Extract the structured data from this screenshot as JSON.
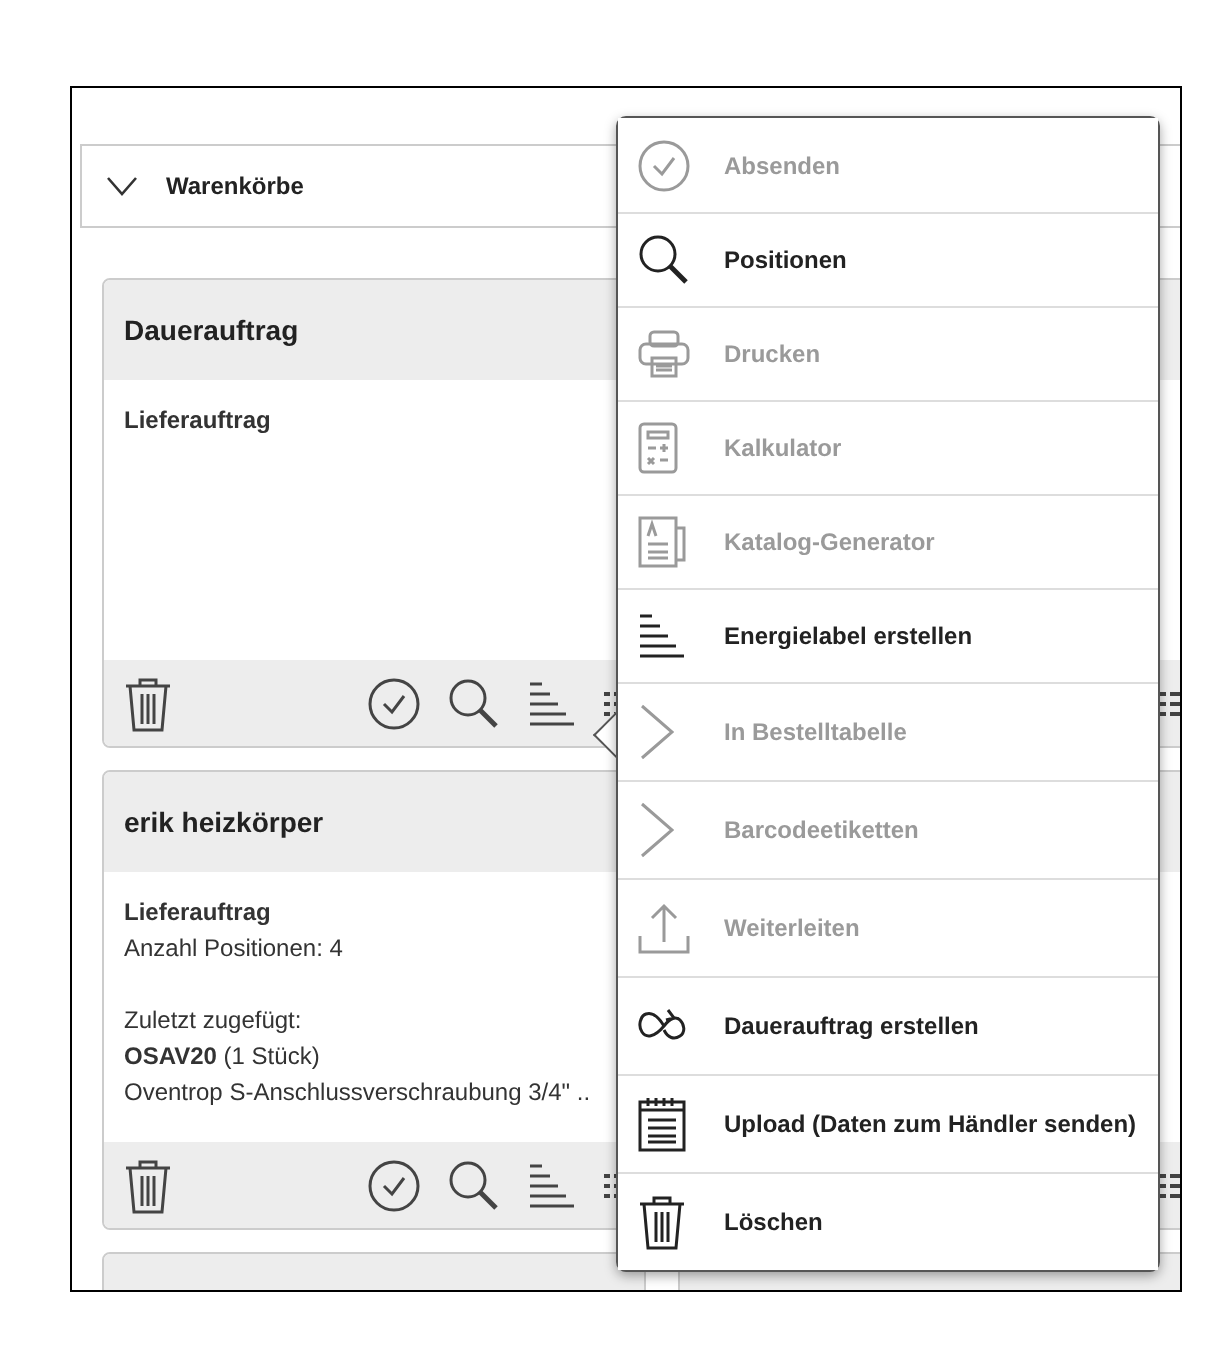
{
  "section": {
    "title": "Warenkörbe",
    "expanded": true
  },
  "carts": [
    {
      "title": "Dauerauftrag",
      "lines": [
        {
          "text": "Lieferauftrag",
          "kind": "bold"
        }
      ]
    },
    {
      "title": "erik heizkörper",
      "lines": [
        {
          "text": "Lieferauftrag",
          "kind": "bold"
        },
        {
          "text": "Anzahl Positionen: 4",
          "kind": "plain"
        },
        {
          "text": "Zuletzt zugefügt:",
          "kind": "spaced"
        },
        {
          "text": "**OSAV20** (1 Stück)",
          "kind": "plain"
        },
        {
          "text": "Oventrop S-Anschlussverschraubung 3/4\" ..",
          "kind": "plain"
        }
      ]
    }
  ],
  "menu": [
    {
      "label": "Absenden",
      "disabled": true
    },
    {
      "label": "Positionen",
      "disabled": false
    },
    {
      "label": "Drucken",
      "disabled": true
    },
    {
      "label": "Kalkulator",
      "disabled": true
    },
    {
      "label": "Katalog-Generator",
      "disabled": true
    },
    {
      "label": "Energielabel erstellen",
      "disabled": false
    },
    {
      "label": "In Bestelltabelle",
      "disabled": true
    },
    {
      "label": "Barcodeetiketten",
      "disabled": true
    },
    {
      "label": "Weiterleiten",
      "disabled": true
    },
    {
      "label": "Dauerauftrag erstellen",
      "disabled": false
    },
    {
      "label": "Upload (Daten zum Händler senden)",
      "disabled": false
    },
    {
      "label": "Löschen",
      "disabled": false
    }
  ]
}
